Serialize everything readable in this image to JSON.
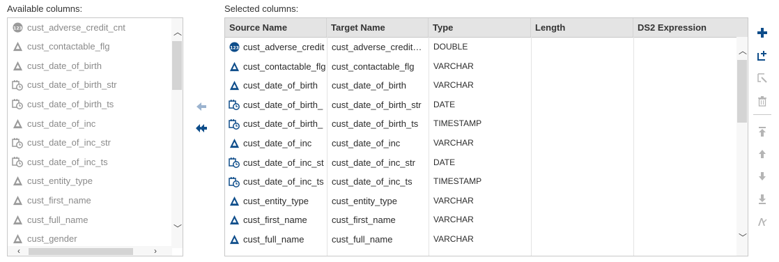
{
  "available": {
    "label": "Available columns:",
    "items": [
      {
        "label": "cust_adverse_credit_cnt",
        "icon": "numeric-icon"
      },
      {
        "label": "cust_contactable_flg",
        "icon": "character-icon"
      },
      {
        "label": "cust_date_of_birth",
        "icon": "character-icon"
      },
      {
        "label": "cust_date_of_birth_str",
        "icon": "datetime-icon"
      },
      {
        "label": "cust_date_of_birth_ts",
        "icon": "datetime-icon"
      },
      {
        "label": "cust_date_of_inc",
        "icon": "character-icon"
      },
      {
        "label": "cust_date_of_inc_str",
        "icon": "datetime-icon"
      },
      {
        "label": "cust_date_of_inc_ts",
        "icon": "datetime-icon"
      },
      {
        "label": "cust_entity_type",
        "icon": "character-icon"
      },
      {
        "label": "cust_first_name",
        "icon": "character-icon"
      },
      {
        "label": "cust_full_name",
        "icon": "character-icon"
      },
      {
        "label": "cust_gender",
        "icon": "character-icon"
      }
    ]
  },
  "selected": {
    "label": "Selected columns:",
    "headers": {
      "source": "Source Name",
      "target": "Target Name",
      "type": "Type",
      "length": "Length",
      "ds2": "DS2 Expression"
    },
    "rows": [
      {
        "source": "cust_adverse_credit",
        "target": "cust_adverse_credit…",
        "type": "DOUBLE",
        "icon": "numeric-icon"
      },
      {
        "source": "cust_contactable_flg",
        "target": "cust_contactable_flg",
        "type": "VARCHAR",
        "icon": "character-icon"
      },
      {
        "source": "cust_date_of_birth",
        "target": "cust_date_of_birth",
        "type": "VARCHAR",
        "icon": "character-icon"
      },
      {
        "source": "cust_date_of_birth_",
        "target": "cust_date_of_birth_str",
        "type": "DATE",
        "icon": "datetime-icon"
      },
      {
        "source": "cust_date_of_birth_",
        "target": "cust_date_of_birth_ts",
        "type": "TIMESTAMP",
        "icon": "datetime-icon"
      },
      {
        "source": "cust_date_of_inc",
        "target": "cust_date_of_inc",
        "type": "VARCHAR",
        "icon": "character-icon"
      },
      {
        "source": "cust_date_of_inc_st",
        "target": "cust_date_of_inc_str",
        "type": "DATE",
        "icon": "datetime-icon"
      },
      {
        "source": "cust_date_of_inc_ts",
        "target": "cust_date_of_inc_ts",
        "type": "TIMESTAMP",
        "icon": "datetime-icon"
      },
      {
        "source": "cust_entity_type",
        "target": "cust_entity_type",
        "type": "VARCHAR",
        "icon": "character-icon"
      },
      {
        "source": "cust_first_name",
        "target": "cust_first_name",
        "type": "VARCHAR",
        "icon": "character-icon"
      },
      {
        "source": "cust_full_name",
        "target": "cust_full_name",
        "type": "VARCHAR",
        "icon": "character-icon"
      }
    ]
  },
  "middle_buttons": [
    "move-left-icon",
    "move-all-left-icon"
  ],
  "toolbar": [
    "add-column-icon",
    "add-calculated-column-icon",
    "edit-column-icon",
    "delete-icon",
    "move-to-top-icon",
    "move-up-icon",
    "move-down-icon",
    "move-to-bottom-icon",
    "rename-icon"
  ],
  "colors": {
    "accent": "#0e4d8a",
    "muted_icon": "#9a9a9a",
    "header_bg": "#e4e4e4"
  }
}
